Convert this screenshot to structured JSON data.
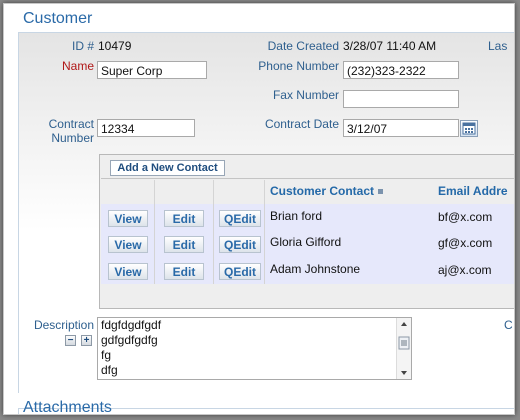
{
  "sections": {
    "customer": "Customer",
    "attachments": "Attachments"
  },
  "fields": {
    "id_label": "ID #",
    "id_value": "10479",
    "date_created_label": "Date Created",
    "date_created_value": "3/28/07 11:40 AM",
    "last_label": "Las",
    "name_label": "Name",
    "name_value": "Super Corp",
    "phone_label": "Phone Number",
    "phone_value": "(232)323-2322",
    "fax_label": "Fax Number",
    "fax_value": "",
    "contract_number_label_1": "Contract",
    "contract_number_label_2": "Number",
    "contract_number_value": "12334",
    "contract_date_label": "Contract Date",
    "contract_date_value": "3/12/07",
    "description_label": "Description",
    "right_cut_label": "C"
  },
  "contacts": {
    "add_button": "Add a New Contact",
    "columns": [
      "Customer Contact",
      "Email Addre"
    ],
    "actions": [
      "View",
      "Edit",
      "QEdit"
    ],
    "rows": [
      {
        "name": "Brian ford",
        "email": "bf@x.com"
      },
      {
        "name": "Gloria Gifford",
        "email": "gf@x.com"
      },
      {
        "name": "Adam Johnstone",
        "email": "aj@x.com"
      }
    ]
  },
  "description": {
    "lines": [
      "fdgfdgdfgdf",
      "gdfgdfgdfg",
      "fg",
      "dfg"
    ],
    "minus": "−",
    "plus": "+"
  },
  "colors": {
    "label": "#2e5f8e",
    "required_label": "#b01818",
    "link": "#2a6aa8",
    "row_bg": "#e6e8fb"
  },
  "icons": {
    "calendar": "calendar-icon",
    "sort": "sort-icon"
  }
}
